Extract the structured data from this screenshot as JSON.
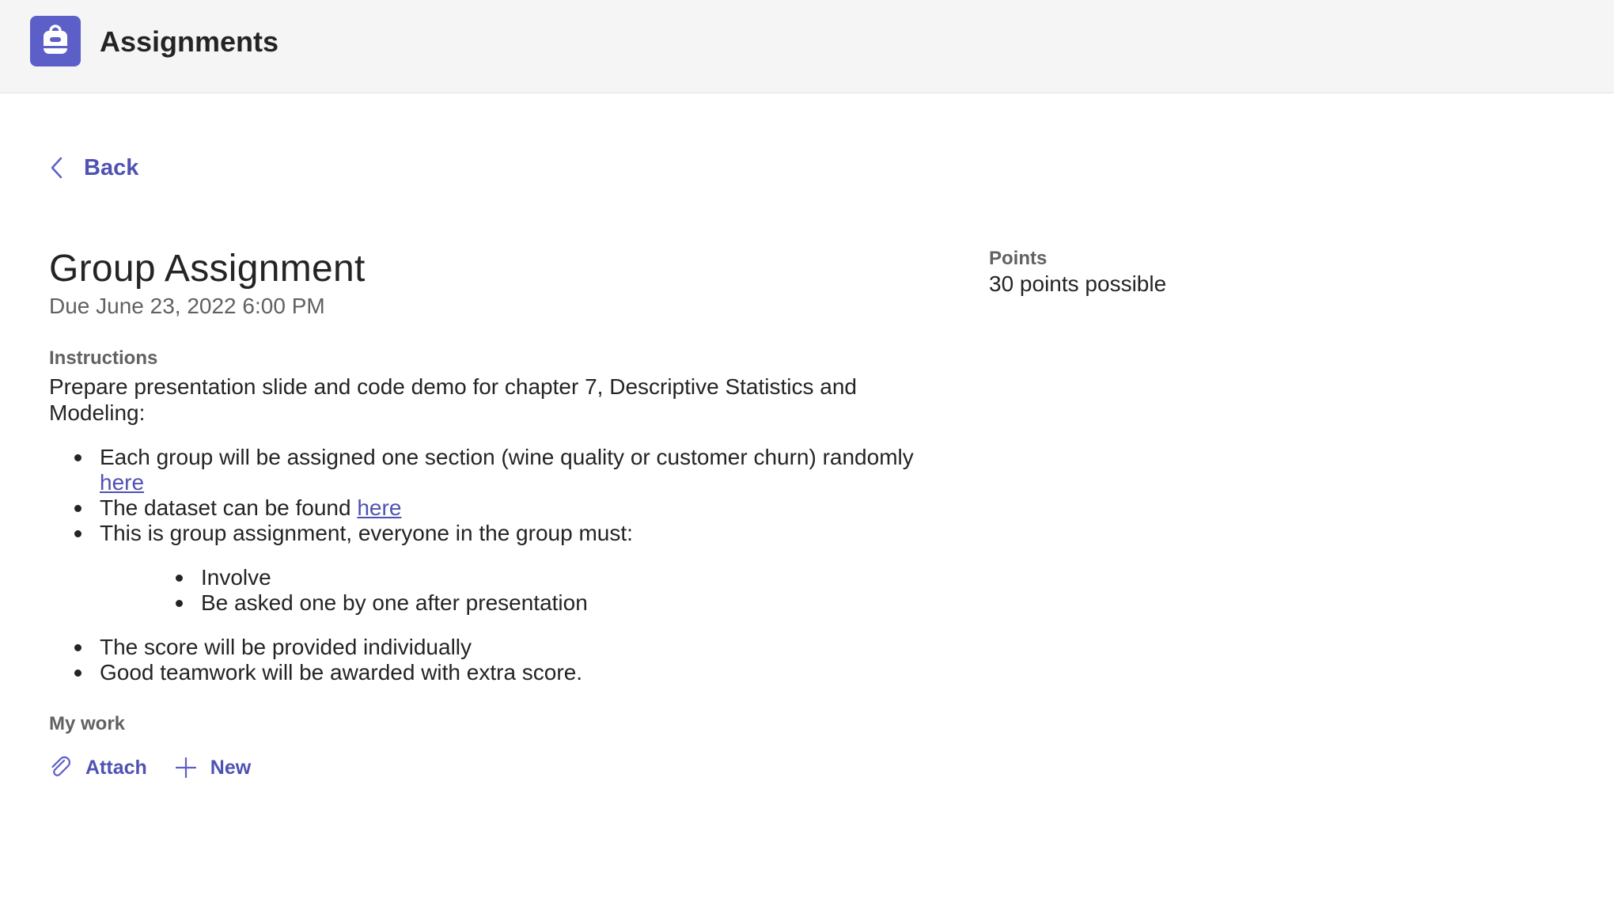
{
  "header": {
    "app_title": "Assignments",
    "app_icon": "backpack-icon",
    "accent_color": "#5b5fc7"
  },
  "nav": {
    "back_label": "Back",
    "back_icon": "chevron-left-icon"
  },
  "assignment": {
    "title": "Group Assignment",
    "due": "Due June 23, 2022 6:00 PM",
    "instructions_label": "Instructions",
    "instructions_intro": "Prepare presentation slide and code demo for chapter 7, Descriptive Statistics and Modeling:",
    "bullets": {
      "b1_text": "Each group will be assigned one section (wine quality or customer churn) randomly ",
      "b1_link": "here",
      "b2_text": "The dataset can be found ",
      "b2_link": "here",
      "b3_text": "This is group assignment, everyone in the group must:",
      "sub1": "Involve",
      "sub2": "Be asked one by one after presentation",
      "b4_text": "The score will be provided individually",
      "b5_text": "Good teamwork will be awarded with extra score."
    }
  },
  "my_work": {
    "label": "My work",
    "attach_label": "Attach",
    "attach_icon": "paperclip-icon",
    "new_label": "New",
    "new_icon": "plus-icon"
  },
  "points": {
    "label": "Points",
    "value": "30 points possible"
  }
}
